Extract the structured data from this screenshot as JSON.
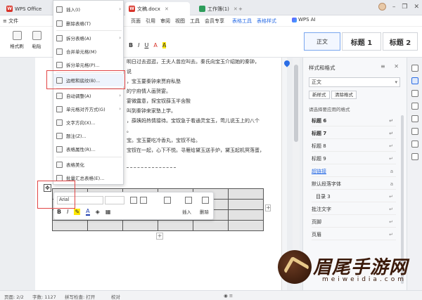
{
  "tabs": [
    {
      "label": "WPS Office"
    },
    {
      "label": "文稿.docx"
    },
    {
      "label": "工作簿(1)"
    }
  ],
  "menu": {
    "file": "≡ 文件",
    "items": [
      "页面",
      "引用",
      "审阅",
      "视图",
      "工具",
      "会员专享"
    ],
    "table_tools": "表格工具",
    "table_style": "表格样式",
    "wps_ai": "WPS AI"
  },
  "ribbon": {
    "format_painter": "格式刷",
    "paste": "粘贴",
    "format_row": [
      "B",
      "I",
      "U",
      "A",
      "A"
    ],
    "styles": [
      {
        "label": "正文"
      },
      {
        "label": "标题 1"
      },
      {
        "label": "标题 2"
      }
    ]
  },
  "document": {
    "lines": [
      "明日过去逛逛，王夫人曾应叫去。秦氏向宝玉介绍她的秦钟，",
      "说",
      "，宝玉要秦钟来贾府私塾",
      "的宁府情人画贺宴。",
      "宴微露意，探宝钗薛玉半含酸",
      "叫到秦钟来家塾上学。",
      "，薛姨妈热情接待。宝钗急于看通灵宝玉，莺儿说玉上的八个",
      "。",
      "宝。宝玉要吃冷香丸，宝钗不给。",
      "宝钗在一起，心下不悦。寻雁给黛玉送手炉，黛玉起机冥落蛋，"
    ]
  },
  "context_menu": {
    "items": [
      {
        "label": "插入(I)",
        "has_submenu": true
      },
      {
        "label": "删除表格(T)",
        "has_submenu": false
      },
      {
        "label": "拆分表格(A)",
        "has_submenu": true
      },
      {
        "label": "合并单元格(M)",
        "has_submenu": false
      },
      {
        "label": "拆分单元格(P)...",
        "has_submenu": false
      },
      {
        "label": "边框和底纹(B)...",
        "has_submenu": false,
        "highlighted": true
      },
      {
        "label": "自动调整(A)",
        "has_submenu": true
      },
      {
        "label": "单元格对齐方式(G)",
        "has_submenu": true
      },
      {
        "label": "文字方向(X)...",
        "has_submenu": false
      },
      {
        "label": "题注(Z)...",
        "has_submenu": false
      },
      {
        "label": "表格属性(R)...",
        "has_submenu": false
      },
      {
        "label": "表格美化",
        "has_submenu": false
      },
      {
        "label": "批量汇总表格(E)...",
        "has_submenu": false
      }
    ]
  },
  "minibar": {
    "font": "Arial",
    "insert_label": "插入",
    "delete_label": "删除"
  },
  "side_panel": {
    "title": "样式和格式",
    "current_style": "正文",
    "new_style": "新样式",
    "clear_format": "清除格式",
    "hint": "请选择要应用的格式",
    "styles": [
      {
        "label": "标题 6",
        "kind": "b"
      },
      {
        "label": "标题 7",
        "kind": "b"
      },
      {
        "label": "标题 8",
        "kind": ""
      },
      {
        "label": "标题 9",
        "kind": ""
      },
      {
        "label": "超链接",
        "kind": "link"
      },
      {
        "label": "默认段落字体",
        "kind": ""
      },
      {
        "label": "目录 3",
        "kind": ""
      },
      {
        "label": "批注文字",
        "kind": ""
      },
      {
        "label": "页脚",
        "kind": ""
      },
      {
        "label": "页眉",
        "kind": ""
      }
    ]
  },
  "status": {
    "page": "页面: 2/2",
    "words": "字数: 1127",
    "spell": "拼写检查: 打开",
    "proof": "校对"
  },
  "watermark": {
    "title": "眉尾手游网",
    "sub": "meiweidia.com"
  },
  "colors": {
    "accent": "#2b6de5",
    "highlight_box": "#e24444",
    "word_red": "#d8342a",
    "sheet_green": "#2d9d5b"
  }
}
